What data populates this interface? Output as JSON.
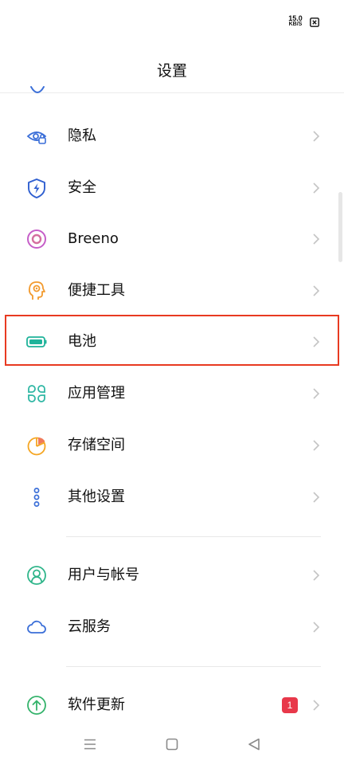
{
  "status_bar": {
    "net_speed_value": "15.0",
    "net_speed_unit": "KB/S"
  },
  "header": {
    "title": "设置"
  },
  "settings_group_1": [
    {
      "label": "隐私",
      "icon": "privacy-eye-icon"
    },
    {
      "label": "安全",
      "icon": "security-shield-icon"
    },
    {
      "label": "Breeno",
      "icon": "breeno-icon"
    },
    {
      "label": "便捷工具",
      "icon": "convenience-tools-icon"
    },
    {
      "label": "电池",
      "icon": "battery-icon"
    },
    {
      "label": "应用管理",
      "icon": "app-management-icon"
    },
    {
      "label": "存储空间",
      "icon": "storage-pie-icon"
    },
    {
      "label": "其他设置",
      "icon": "other-settings-icon"
    }
  ],
  "settings_group_2": [
    {
      "label": "用户与帐号",
      "icon": "user-account-icon"
    },
    {
      "label": "云服务",
      "icon": "cloud-icon"
    }
  ],
  "settings_group_3": [
    {
      "label": "软件更新",
      "icon": "software-update-icon",
      "badge": "1"
    }
  ],
  "colors": {
    "highlight": "#e83a21",
    "badge": "#e8384a",
    "privacy": "#3b6fd8",
    "breeno": "#c65ec8",
    "tools": "#f29a2e",
    "battery": "#1fb39a",
    "apps": "#2fb7a4",
    "storage": "#f5a623",
    "user": "#2fb58a",
    "cloud": "#3b6fd8",
    "update": "#34b36b"
  }
}
